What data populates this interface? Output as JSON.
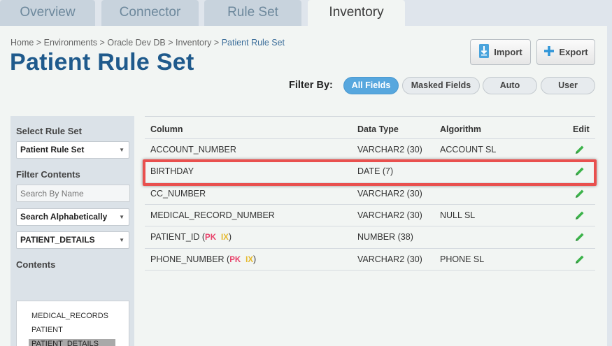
{
  "tabs": [
    {
      "label": "Overview"
    },
    {
      "label": "Connector"
    },
    {
      "label": "Rule Set"
    },
    {
      "label": "Inventory"
    }
  ],
  "breadcrumb": {
    "items": [
      "Home",
      "Environments",
      "Oracle Dev DB",
      "Inventory"
    ],
    "current": "Patient Rule Set",
    "separator": ">"
  },
  "page_title": "Patient Rule Set",
  "actions": {
    "import_label": "Import",
    "export_label": "Export"
  },
  "filter": {
    "label": "Filter By:",
    "options": [
      "All Fields",
      "Masked Fields",
      "Auto",
      "User"
    ],
    "selected": "All Fields"
  },
  "sidebar": {
    "rule_set_heading": "Select Rule Set",
    "rule_set_value": "Patient Rule Set",
    "filter_heading": "Filter Contents",
    "search_placeholder": "Search By Name",
    "sort_value": "Search Alphabetically",
    "table_value": "PATIENT_DETAILS",
    "contents_heading": "Contents",
    "contents": [
      "MEDICAL_RECORDS",
      "PATIENT",
      "PATIENT_DETAILS"
    ],
    "selected_content": "PATIENT_DETAILS"
  },
  "table": {
    "headers": {
      "column": "Column",
      "type": "Data Type",
      "algorithm": "Algorithm",
      "edit": "Edit"
    },
    "rows": [
      {
        "column": "ACCOUNT_NUMBER",
        "pk": "",
        "ix": "",
        "type": "VARCHAR2 (30)",
        "algorithm": "ACCOUNT SL"
      },
      {
        "column": "BIRTHDAY",
        "pk": "",
        "ix": "",
        "type": "DATE (7)",
        "algorithm": ""
      },
      {
        "column": "CC_NUMBER",
        "pk": "",
        "ix": "",
        "type": "VARCHAR2 (30)",
        "algorithm": ""
      },
      {
        "column": "MEDICAL_RECORD_NUMBER",
        "pk": "",
        "ix": "",
        "type": "VARCHAR2 (30)",
        "algorithm": "NULL SL"
      },
      {
        "column": "PATIENT_ID",
        "pk": "PK",
        "ix": "IX",
        "type": "NUMBER (38)",
        "algorithm": ""
      },
      {
        "column": "PHONE_NUMBER",
        "pk": "PK",
        "ix": "IX",
        "type": "VARCHAR2 (30)",
        "algorithm": "PHONE SL"
      }
    ],
    "highlighted_row": "BIRTHDAY"
  },
  "colors": {
    "title": "#1f5a8c",
    "active_filter": "#57a7de",
    "pk": "#e8436b",
    "ix": "#e5b92d",
    "edit_icon": "#3cb34a",
    "highlight": "#e9504e"
  }
}
